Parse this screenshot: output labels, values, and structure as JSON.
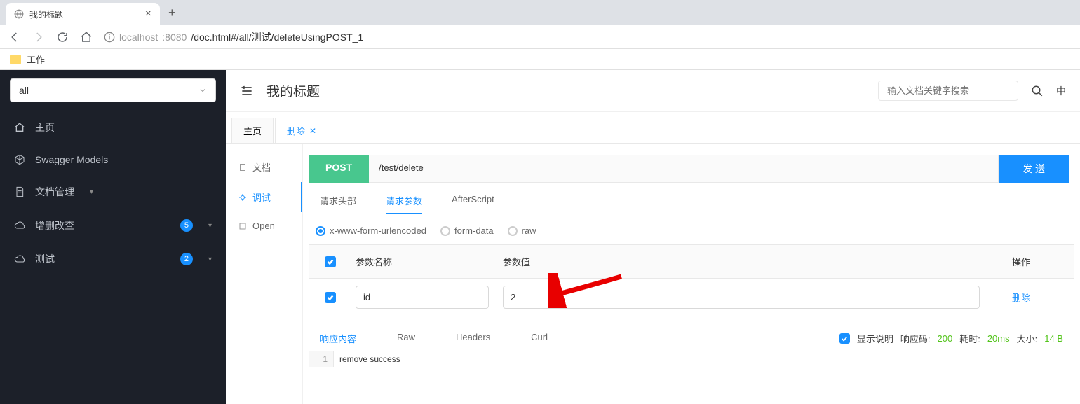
{
  "browser": {
    "tab_title": "我的标题",
    "url_host": "localhost",
    "url_port": ":8080",
    "url_path": "/doc.html#/all/测试/deleteUsingPOST_1",
    "bookmark": "工作"
  },
  "sidebar": {
    "api_select": "all",
    "items": [
      {
        "label": "主页"
      },
      {
        "label": "Swagger Models"
      },
      {
        "label": "文档管理"
      },
      {
        "label": "增删改查",
        "badge": "5"
      },
      {
        "label": "测试",
        "badge": "2"
      }
    ]
  },
  "header": {
    "title": "我的标题",
    "search_placeholder": "输入文档关键字搜索",
    "lang": "中"
  },
  "tabs": [
    {
      "label": "主页",
      "closable": false
    },
    {
      "label": "删除",
      "closable": true,
      "active": true
    }
  ],
  "sub_nav": [
    {
      "label": "文档"
    },
    {
      "label": "调试",
      "active": true
    },
    {
      "label": "Open"
    }
  ],
  "request": {
    "method": "POST",
    "path": "/test/delete",
    "send": "发 送",
    "tabs": [
      {
        "label": "请求头部"
      },
      {
        "label": "请求参数",
        "active": true
      },
      {
        "label": "AfterScript"
      }
    ],
    "encodings": [
      {
        "label": "x-www-form-urlencoded",
        "checked": true
      },
      {
        "label": "form-data"
      },
      {
        "label": "raw"
      }
    ],
    "param_headers": {
      "name": "参数名称",
      "value": "参数值",
      "op": "操作"
    },
    "params": [
      {
        "name": "id",
        "value": "2",
        "op": "删除"
      }
    ]
  },
  "response": {
    "tabs": [
      {
        "label": "响应内容",
        "active": true
      },
      {
        "label": "Raw"
      },
      {
        "label": "Headers"
      },
      {
        "label": "Curl"
      }
    ],
    "show_desc": "显示说明",
    "status_label": "响应码:",
    "status_value": "200",
    "time_label": "耗时:",
    "time_value": "20ms",
    "size_label": "大小:",
    "size_value": "14 B",
    "body": "remove success"
  }
}
